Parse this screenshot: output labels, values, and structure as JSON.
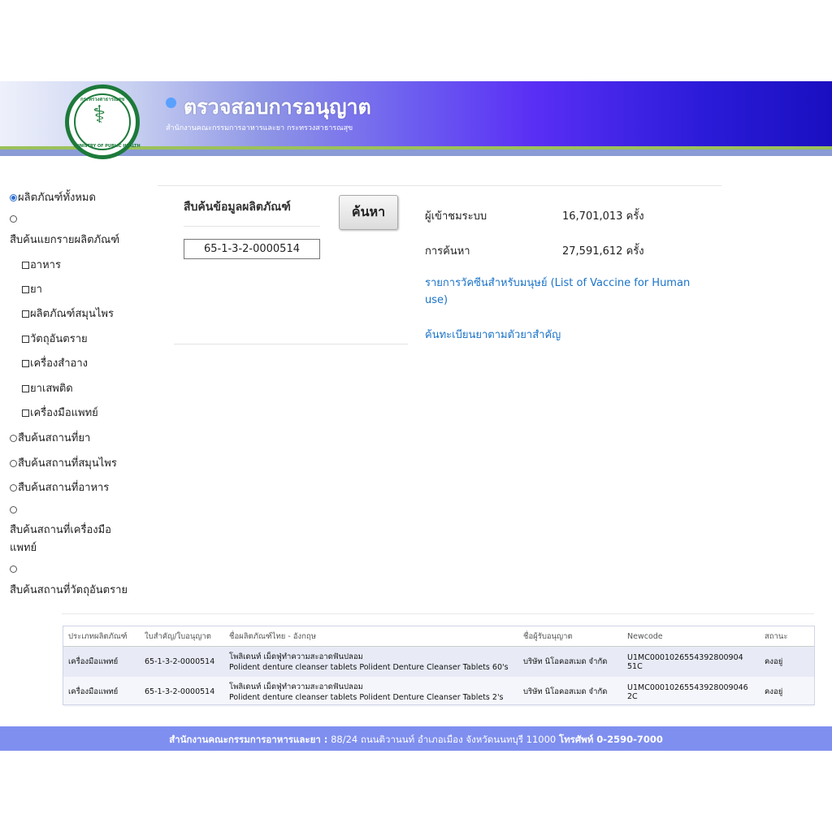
{
  "header": {
    "title": "ตรวจสอบการอนุญาต",
    "subtitle": "สำนักงานคณะกรรมการอาหารและยา กระทรวงสาธารณสุข",
    "logo_text_top": "กระทรวงสาธารณสุข",
    "logo_text_bottom": "MINISTRY OF PUBLIC HEALTH"
  },
  "menu": {
    "all_products": "ผลิตภัณฑ์ทั้งหมด",
    "by_category": "สืบค้นแยกรายผลิตภัณฑ์",
    "categories": [
      "อาหาร",
      "ยา",
      "ผลิตภัณฑ์สมุนไพร",
      "วัตถุอันตราย",
      "เครื่องสำอาง",
      "ยาเสพติด",
      "เครื่องมือแพทย์"
    ],
    "drug_places": "สืบค้นสถานที่ยา",
    "herb_places": "สืบค้นสถานที่สมุนไพร",
    "food_places": "สืบค้นสถานที่อาหาร",
    "device_places_line1": "สืบค้นสถานที่เครื่องมือ",
    "device_places_line2": "แพทย์",
    "hazard_places": "สืบค้นสถานที่วัตถุอันตราย"
  },
  "search": {
    "label": "สืบค้นข้อมูลผลิตภัณฑ์",
    "value": "65-1-3-2-0000514",
    "button": "ค้นหา"
  },
  "stats": {
    "visitors_label": "ผู้เข้าชมระบบ",
    "visitors_value": "16,701,013 ครั้ง",
    "searches_label": "การค้นหา",
    "searches_value": "27,591,612 ครั้ง"
  },
  "links": {
    "vaccine": "รายการวัคซีนสำหรับมนุษย์ (List of Vaccine for Human use)",
    "drug_registry": "ค้นทะเบียนยาตามตัวยาสำคัญ"
  },
  "table": {
    "headers": [
      "ประเภทผลิตภัณฑ์",
      "ใบสำคัญ/ใบอนุญาต",
      "ชื่อผลิตภัณฑ์ไทย - อังกฤษ",
      "ชื่อผู้รับอนุญาต",
      "Newcode",
      "สถานะ"
    ],
    "rows": [
      {
        "type": "เครื่องมือแพทย์",
        "license": "65-1-3-2-0000514",
        "name_th": "โพลิเดนท์ เม็ดฟู่ทำความสะอาดฟันปลอม",
        "name_en": "Polident denture cleanser tablets Polident Denture Cleanser Tablets 60's",
        "licensee": "บริษัท นิโอคอสเมด จำกัด",
        "newcode": "U1MC0001026554392800904 51C",
        "status": "คงอยู่"
      },
      {
        "type": "เครื่องมือแพทย์",
        "license": "65-1-3-2-0000514",
        "name_th": "โพลิเดนท์ เม็ดฟู่ทำความสะอาดฟันปลอม",
        "name_en": "Polident denture cleanser tablets Polident Denture Cleanser Tablets 2's",
        "licensee": "บริษัท นิโอคอสเมด จำกัด",
        "newcode": "U1MC00010265543928009046 2C",
        "status": "คงอยู่"
      }
    ]
  },
  "footer": {
    "org": "สำนักงานคณะกรรมการอาหารและยา :",
    "address": "88/24 ถนนติวานนท์ อำเภอเมือง จังหวัดนนทบุรี 11000",
    "phone": "โทรศัพท์ 0-2590-7000"
  },
  "colors": {
    "link": "#1a73c8",
    "footer": "#7f8ff0",
    "banner_end": "#1a0fc0",
    "accent_green": "#1c7a3a"
  }
}
